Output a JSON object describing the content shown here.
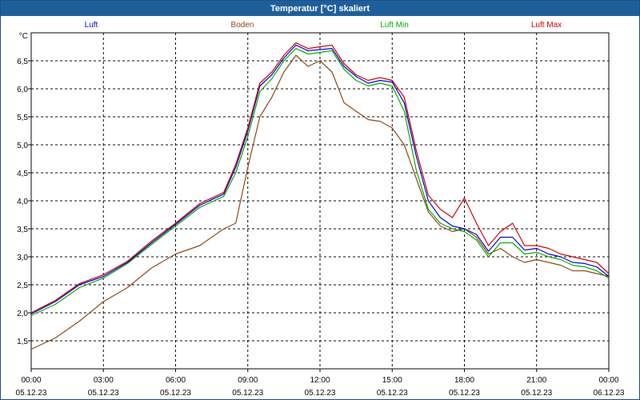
{
  "window": {
    "title": "Temperatur [°C] skaliert"
  },
  "chart_data": {
    "type": "line",
    "title": "Temperatur [°C] skaliert",
    "ylabel": "°C",
    "ylim": [
      1.0,
      7.0
    ],
    "yticks": [
      1.5,
      2.0,
      2.5,
      3.0,
      3.5,
      4.0,
      4.5,
      5.0,
      5.5,
      6.0,
      6.5
    ],
    "ytick_labels": [
      "1,5",
      "2,0",
      "2,5",
      "3,0",
      "3,5",
      "4,0",
      "4,5",
      "5,0",
      "5,5",
      "6,0",
      "6,5"
    ],
    "xlim": [
      0,
      24
    ],
    "xticks": [
      0,
      3,
      6,
      9,
      12,
      15,
      18,
      21,
      24
    ],
    "xtick_labels": [
      {
        "time": "00:00",
        "date": "05.12.23"
      },
      {
        "time": "03:00",
        "date": "05.12.23"
      },
      {
        "time": "06:00",
        "date": "05.12.23"
      },
      {
        "time": "09:00",
        "date": "05.12.23"
      },
      {
        "time": "12:00",
        "date": "05.12.23"
      },
      {
        "time": "15:00",
        "date": "05.12.23"
      },
      {
        "time": "18:00",
        "date": "05.12.23"
      },
      {
        "time": "21:00",
        "date": "05.12.23"
      },
      {
        "time": "00:00",
        "date": "06.12.23"
      }
    ],
    "grid": true,
    "legend_position": "top",
    "x": [
      0,
      1,
      2,
      3,
      4,
      5,
      6,
      7,
      8,
      8.5,
      9,
      9.5,
      10,
      10.5,
      11,
      11.5,
      12,
      12.5,
      13,
      13.5,
      14,
      14.5,
      15,
      15.5,
      16,
      16.5,
      17,
      17.5,
      18,
      18.5,
      19,
      19.5,
      20,
      20.5,
      21,
      21.5,
      22,
      22.5,
      23,
      23.5,
      24
    ],
    "series": [
      {
        "name": "Luft",
        "color": "#0000cc",
        "values": [
          1.98,
          2.2,
          2.5,
          2.65,
          2.9,
          3.25,
          3.58,
          3.92,
          4.12,
          4.6,
          5.25,
          6.05,
          6.25,
          6.55,
          6.78,
          6.68,
          6.7,
          6.72,
          6.4,
          6.22,
          6.1,
          6.15,
          6.12,
          5.75,
          4.8,
          4.0,
          3.7,
          3.55,
          3.5,
          3.4,
          3.1,
          3.35,
          3.35,
          3.12,
          3.15,
          3.05,
          3.0,
          2.9,
          2.88,
          2.82,
          2.65
        ]
      },
      {
        "name": "Boden",
        "color": "#8b4513",
        "values": [
          1.35,
          1.55,
          1.85,
          2.2,
          2.45,
          2.8,
          3.05,
          3.2,
          3.5,
          3.6,
          4.6,
          5.5,
          5.85,
          6.3,
          6.6,
          6.4,
          6.5,
          6.3,
          5.75,
          5.6,
          5.45,
          5.42,
          5.3,
          5.0,
          4.4,
          3.8,
          3.55,
          3.45,
          3.5,
          3.35,
          3.05,
          3.15,
          3.0,
          2.9,
          2.95,
          2.9,
          2.85,
          2.75,
          2.75,
          2.7,
          2.65
        ]
      },
      {
        "name": "Luft Min",
        "color": "#00aa00",
        "values": [
          1.95,
          2.15,
          2.45,
          2.62,
          2.88,
          3.22,
          3.55,
          3.88,
          4.08,
          4.5,
          5.15,
          5.95,
          6.18,
          6.5,
          6.72,
          6.62,
          6.65,
          6.68,
          6.35,
          6.15,
          6.05,
          6.1,
          6.05,
          5.6,
          4.55,
          3.85,
          3.6,
          3.5,
          3.45,
          3.3,
          3.0,
          3.25,
          3.25,
          3.05,
          3.08,
          3.0,
          2.95,
          2.85,
          2.82,
          2.75,
          2.62
        ]
      },
      {
        "name": "Luft Max",
        "color": "#cc0000",
        "values": [
          2.0,
          2.22,
          2.52,
          2.68,
          2.92,
          3.28,
          3.6,
          3.95,
          4.15,
          4.65,
          5.3,
          6.1,
          6.3,
          6.6,
          6.82,
          6.72,
          6.75,
          6.78,
          6.45,
          6.25,
          6.15,
          6.2,
          6.15,
          5.85,
          4.9,
          4.1,
          3.85,
          3.7,
          4.05,
          3.6,
          3.2,
          3.45,
          3.6,
          3.2,
          3.2,
          3.15,
          3.05,
          3.0,
          2.95,
          2.9,
          2.7
        ]
      }
    ]
  }
}
